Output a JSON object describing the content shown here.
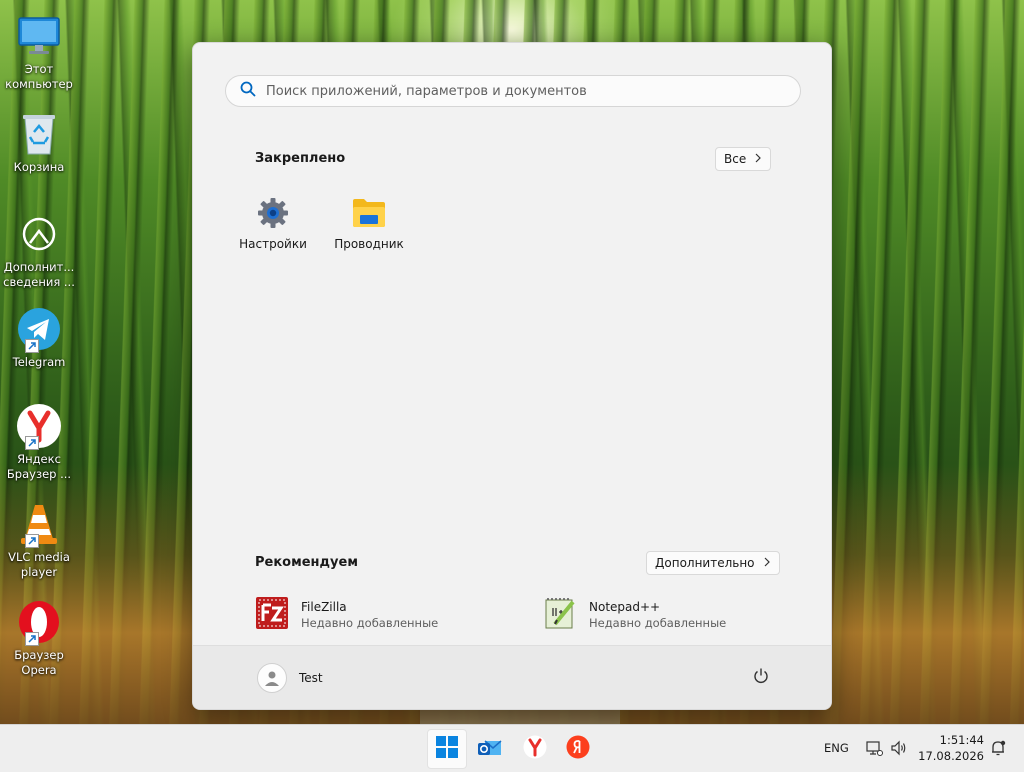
{
  "desktop": {
    "icons": [
      {
        "label": "Этот компьютер"
      },
      {
        "label": "Корзина"
      },
      {
        "label": "Дополнит... сведения ..."
      },
      {
        "label": "Telegram"
      },
      {
        "label": "Яндекс Браузер ..."
      },
      {
        "label": "VLC media player"
      },
      {
        "label": "Браузер Opera"
      }
    ]
  },
  "start_menu": {
    "search": {
      "placeholder": "Поиск приложений, параметров и документов"
    },
    "pinned": {
      "title": "Закреплено",
      "all_button": "Все",
      "apps": [
        {
          "label": "Настройки",
          "icon": "settings-gear-icon"
        },
        {
          "label": "Проводник",
          "icon": "file-explorer-folder-icon"
        }
      ]
    },
    "recommended": {
      "title": "Рекомендуем",
      "more_button": "Дополнительно",
      "items": [
        {
          "name": "FileZilla",
          "subtitle": "Недавно добавленные",
          "icon": "filezilla-icon"
        },
        {
          "name": "Notepad++",
          "subtitle": "Недавно добавленные",
          "icon": "notepad-plus-plus-icon"
        }
      ]
    },
    "user": {
      "name": "Test"
    },
    "power": {
      "icon": "power-icon"
    }
  },
  "taskbar": {
    "buttons": [
      "start-icon",
      "outlook-icon",
      "yandex-browser-icon",
      "yandex-icon"
    ],
    "tray": {
      "language": "ENG",
      "time": "1:51:44",
      "date": "17.08.2026"
    }
  },
  "colors": {
    "accent": "#0067c0",
    "menu_bg": "#f2f2f2",
    "taskbar_bg": "#eeeeee"
  }
}
